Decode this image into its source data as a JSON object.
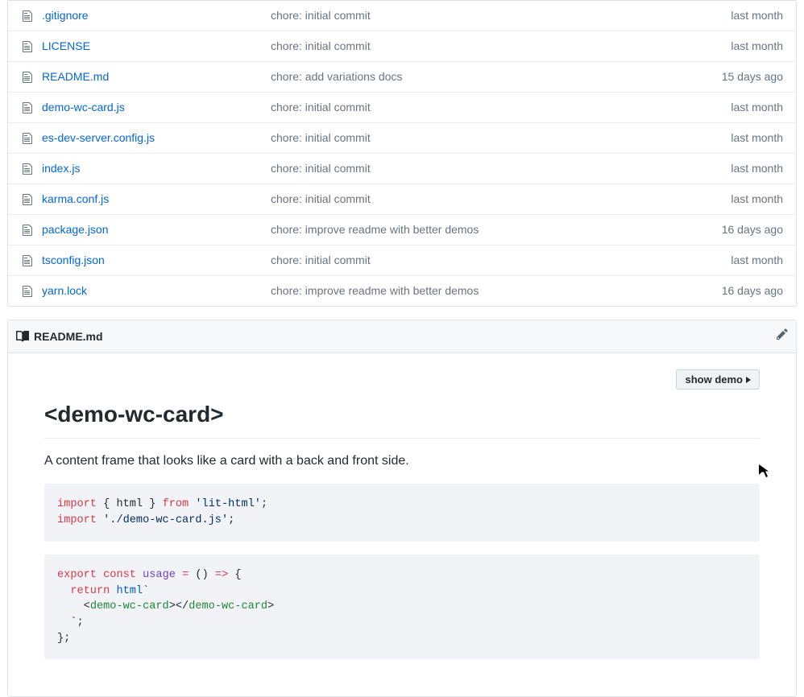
{
  "files": [
    {
      "name": ".gitignore",
      "msg": "chore: initial commit",
      "time": "last month"
    },
    {
      "name": "LICENSE",
      "msg": "chore: initial commit",
      "time": "last month"
    },
    {
      "name": "README.md",
      "msg": "chore: add variations docs",
      "time": "15 days ago"
    },
    {
      "name": "demo-wc-card.js",
      "msg": "chore: initial commit",
      "time": "last month"
    },
    {
      "name": "es-dev-server.config.js",
      "msg": "chore: initial commit",
      "time": "last month"
    },
    {
      "name": "index.js",
      "msg": "chore: initial commit",
      "time": "last month"
    },
    {
      "name": "karma.conf.js",
      "msg": "chore: initial commit",
      "time": "last month"
    },
    {
      "name": "package.json",
      "msg": "chore: improve readme with better demos",
      "time": "16 days ago"
    },
    {
      "name": "tsconfig.json",
      "msg": "chore: initial commit",
      "time": "last month"
    },
    {
      "name": "yarn.lock",
      "msg": "chore: improve readme with better demos",
      "time": "16 days ago"
    }
  ],
  "readme": {
    "filename": "README.md",
    "show_demo_label": "show demo",
    "heading": "<demo-wc-card>",
    "description": "A content frame that looks like a card with a back and front side.",
    "code1": {
      "t1": "import",
      "t2": "{ html }",
      "t3": "from",
      "t4": "'lit-html'",
      "t5": ";",
      "t6": "import",
      "t7": "'./demo-wc-card.js'",
      "t8": ";"
    },
    "code2": {
      "t1": "export",
      "t2": "const",
      "t3": "usage",
      "t4": "=",
      "t5": "()",
      "t6": "=>",
      "t7": "{",
      "t8": "return",
      "t9": "html",
      "t10": "`",
      "t11": "<",
      "t12": "demo-wc-card",
      "t13": "></",
      "t14": "demo-wc-card",
      "t15": ">",
      "t16": "`",
      "t17": ";",
      "t18": "};"
    }
  }
}
